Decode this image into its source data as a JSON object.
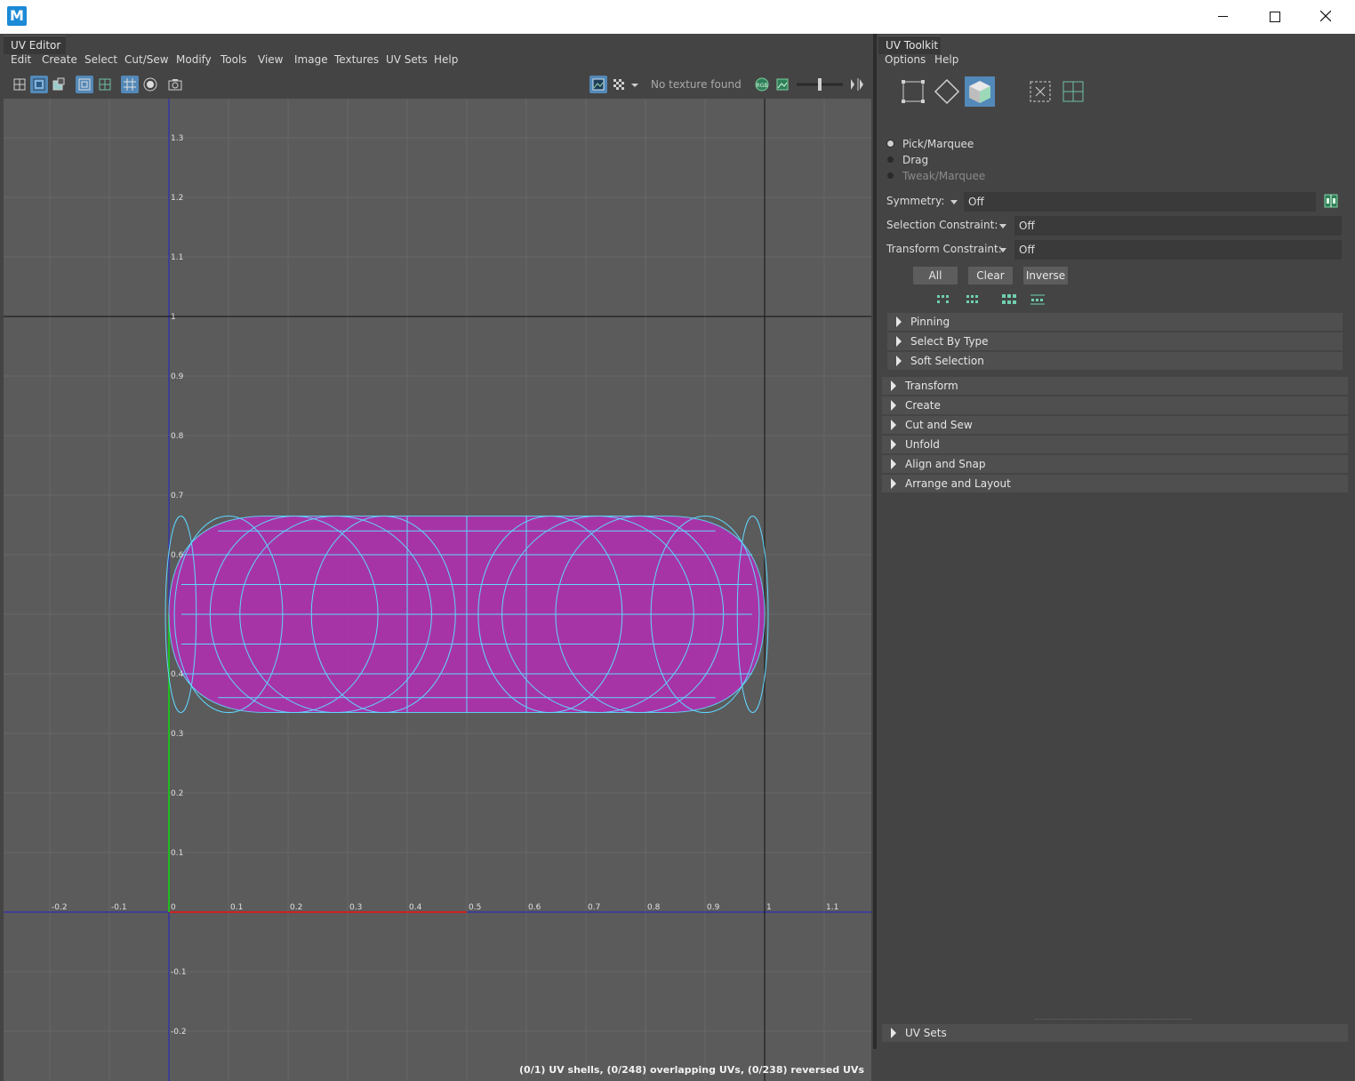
{
  "window": {
    "logo_letter": "M",
    "minimize_label": "—",
    "maximize_label": "☐",
    "close_label": "✕"
  },
  "uv_editor": {
    "title": "UV Editor",
    "menu": [
      "Edit",
      "Create",
      "Select",
      "Cut/Sew",
      "Modify",
      "Tools",
      "View",
      "Image",
      "Textures",
      "UV Sets",
      "Help"
    ],
    "texture_status": "No texture found",
    "status_text": "(0/1) UV shells, (0/248) overlapping UVs, (0/238) reversed UVs",
    "grid": {
      "u_ticks": [
        "-0.2",
        "-0.1",
        "0",
        "0.1",
        "0.2",
        "0.3",
        "0.4",
        "0.5",
        "0.6",
        "0.7",
        "0.8",
        "0.9",
        "1",
        "1.1"
      ],
      "v_ticks": [
        "1.3",
        "1.2",
        "1.1",
        "1",
        "0.9",
        "0.8",
        "0.7",
        "0.6",
        "0.4",
        "0.3",
        "0.2",
        "0.1",
        "-0.1",
        "-0.2"
      ]
    },
    "colors": {
      "viewport_bg": "#5b5b5b",
      "uv_shell_fill": "#b030b0",
      "uv_wire": "#5fd7ff",
      "u_axis": "#cc2222",
      "v_axis": "#22bb22",
      "origin_axis": "#2020c8"
    }
  },
  "uv_toolkit": {
    "title": "UV Toolkit",
    "menu": [
      "Options",
      "Help"
    ],
    "modes": [
      "vertex-mode-icon",
      "edge-mode-icon",
      "face-mode-icon",
      "uv-shell-icon",
      "uv-grid-icon"
    ],
    "selection_modes": [
      {
        "label": "Pick/Marquee",
        "selected": true,
        "enabled": true
      },
      {
        "label": "Drag",
        "selected": false,
        "enabled": true
      },
      {
        "label": "Tweak/Marquee",
        "selected": false,
        "enabled": false
      }
    ],
    "symmetry": {
      "label": "Symmetry:",
      "value": "Off"
    },
    "selection_constraint": {
      "label": "Selection Constraint:",
      "value": "Off"
    },
    "transform_constraint": {
      "label": "Transform Constraint:",
      "value": "Off"
    },
    "buttons": {
      "all": "All",
      "clear": "Clear",
      "inverse": "Inverse"
    },
    "subsections": [
      "Pinning",
      "Select By Type",
      "Soft Selection"
    ],
    "sections": [
      "Transform",
      "Create",
      "Cut and Sew",
      "Unfold",
      "Align and Snap",
      "Arrange and Layout"
    ],
    "bottom_section": "UV Sets"
  }
}
